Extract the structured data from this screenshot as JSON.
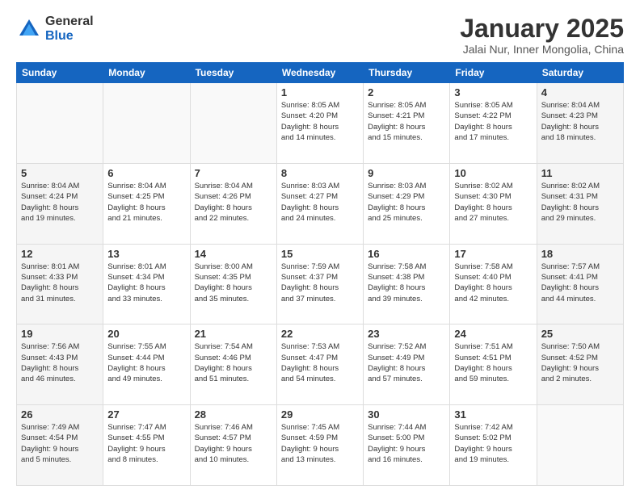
{
  "logo": {
    "general": "General",
    "blue": "Blue"
  },
  "title": "January 2025",
  "subtitle": "Jalai Nur, Inner Mongolia, China",
  "days_of_week": [
    "Sunday",
    "Monday",
    "Tuesday",
    "Wednesday",
    "Thursday",
    "Friday",
    "Saturday"
  ],
  "weeks": [
    [
      {
        "day": "",
        "info": ""
      },
      {
        "day": "",
        "info": ""
      },
      {
        "day": "",
        "info": ""
      },
      {
        "day": "1",
        "info": "Sunrise: 8:05 AM\nSunset: 4:20 PM\nDaylight: 8 hours\nand 14 minutes."
      },
      {
        "day": "2",
        "info": "Sunrise: 8:05 AM\nSunset: 4:21 PM\nDaylight: 8 hours\nand 15 minutes."
      },
      {
        "day": "3",
        "info": "Sunrise: 8:05 AM\nSunset: 4:22 PM\nDaylight: 8 hours\nand 17 minutes."
      },
      {
        "day": "4",
        "info": "Sunrise: 8:04 AM\nSunset: 4:23 PM\nDaylight: 8 hours\nand 18 minutes."
      }
    ],
    [
      {
        "day": "5",
        "info": "Sunrise: 8:04 AM\nSunset: 4:24 PM\nDaylight: 8 hours\nand 19 minutes."
      },
      {
        "day": "6",
        "info": "Sunrise: 8:04 AM\nSunset: 4:25 PM\nDaylight: 8 hours\nand 21 minutes."
      },
      {
        "day": "7",
        "info": "Sunrise: 8:04 AM\nSunset: 4:26 PM\nDaylight: 8 hours\nand 22 minutes."
      },
      {
        "day": "8",
        "info": "Sunrise: 8:03 AM\nSunset: 4:27 PM\nDaylight: 8 hours\nand 24 minutes."
      },
      {
        "day": "9",
        "info": "Sunrise: 8:03 AM\nSunset: 4:29 PM\nDaylight: 8 hours\nand 25 minutes."
      },
      {
        "day": "10",
        "info": "Sunrise: 8:02 AM\nSunset: 4:30 PM\nDaylight: 8 hours\nand 27 minutes."
      },
      {
        "day": "11",
        "info": "Sunrise: 8:02 AM\nSunset: 4:31 PM\nDaylight: 8 hours\nand 29 minutes."
      }
    ],
    [
      {
        "day": "12",
        "info": "Sunrise: 8:01 AM\nSunset: 4:33 PM\nDaylight: 8 hours\nand 31 minutes."
      },
      {
        "day": "13",
        "info": "Sunrise: 8:01 AM\nSunset: 4:34 PM\nDaylight: 8 hours\nand 33 minutes."
      },
      {
        "day": "14",
        "info": "Sunrise: 8:00 AM\nSunset: 4:35 PM\nDaylight: 8 hours\nand 35 minutes."
      },
      {
        "day": "15",
        "info": "Sunrise: 7:59 AM\nSunset: 4:37 PM\nDaylight: 8 hours\nand 37 minutes."
      },
      {
        "day": "16",
        "info": "Sunrise: 7:58 AM\nSunset: 4:38 PM\nDaylight: 8 hours\nand 39 minutes."
      },
      {
        "day": "17",
        "info": "Sunrise: 7:58 AM\nSunset: 4:40 PM\nDaylight: 8 hours\nand 42 minutes."
      },
      {
        "day": "18",
        "info": "Sunrise: 7:57 AM\nSunset: 4:41 PM\nDaylight: 8 hours\nand 44 minutes."
      }
    ],
    [
      {
        "day": "19",
        "info": "Sunrise: 7:56 AM\nSunset: 4:43 PM\nDaylight: 8 hours\nand 46 minutes."
      },
      {
        "day": "20",
        "info": "Sunrise: 7:55 AM\nSunset: 4:44 PM\nDaylight: 8 hours\nand 49 minutes."
      },
      {
        "day": "21",
        "info": "Sunrise: 7:54 AM\nSunset: 4:46 PM\nDaylight: 8 hours\nand 51 minutes."
      },
      {
        "day": "22",
        "info": "Sunrise: 7:53 AM\nSunset: 4:47 PM\nDaylight: 8 hours\nand 54 minutes."
      },
      {
        "day": "23",
        "info": "Sunrise: 7:52 AM\nSunset: 4:49 PM\nDaylight: 8 hours\nand 57 minutes."
      },
      {
        "day": "24",
        "info": "Sunrise: 7:51 AM\nSunset: 4:51 PM\nDaylight: 8 hours\nand 59 minutes."
      },
      {
        "day": "25",
        "info": "Sunrise: 7:50 AM\nSunset: 4:52 PM\nDaylight: 9 hours\nand 2 minutes."
      }
    ],
    [
      {
        "day": "26",
        "info": "Sunrise: 7:49 AM\nSunset: 4:54 PM\nDaylight: 9 hours\nand 5 minutes."
      },
      {
        "day": "27",
        "info": "Sunrise: 7:47 AM\nSunset: 4:55 PM\nDaylight: 9 hours\nand 8 minutes."
      },
      {
        "day": "28",
        "info": "Sunrise: 7:46 AM\nSunset: 4:57 PM\nDaylight: 9 hours\nand 10 minutes."
      },
      {
        "day": "29",
        "info": "Sunrise: 7:45 AM\nSunset: 4:59 PM\nDaylight: 9 hours\nand 13 minutes."
      },
      {
        "day": "30",
        "info": "Sunrise: 7:44 AM\nSunset: 5:00 PM\nDaylight: 9 hours\nand 16 minutes."
      },
      {
        "day": "31",
        "info": "Sunrise: 7:42 AM\nSunset: 5:02 PM\nDaylight: 9 hours\nand 19 minutes."
      },
      {
        "day": "",
        "info": ""
      }
    ]
  ]
}
